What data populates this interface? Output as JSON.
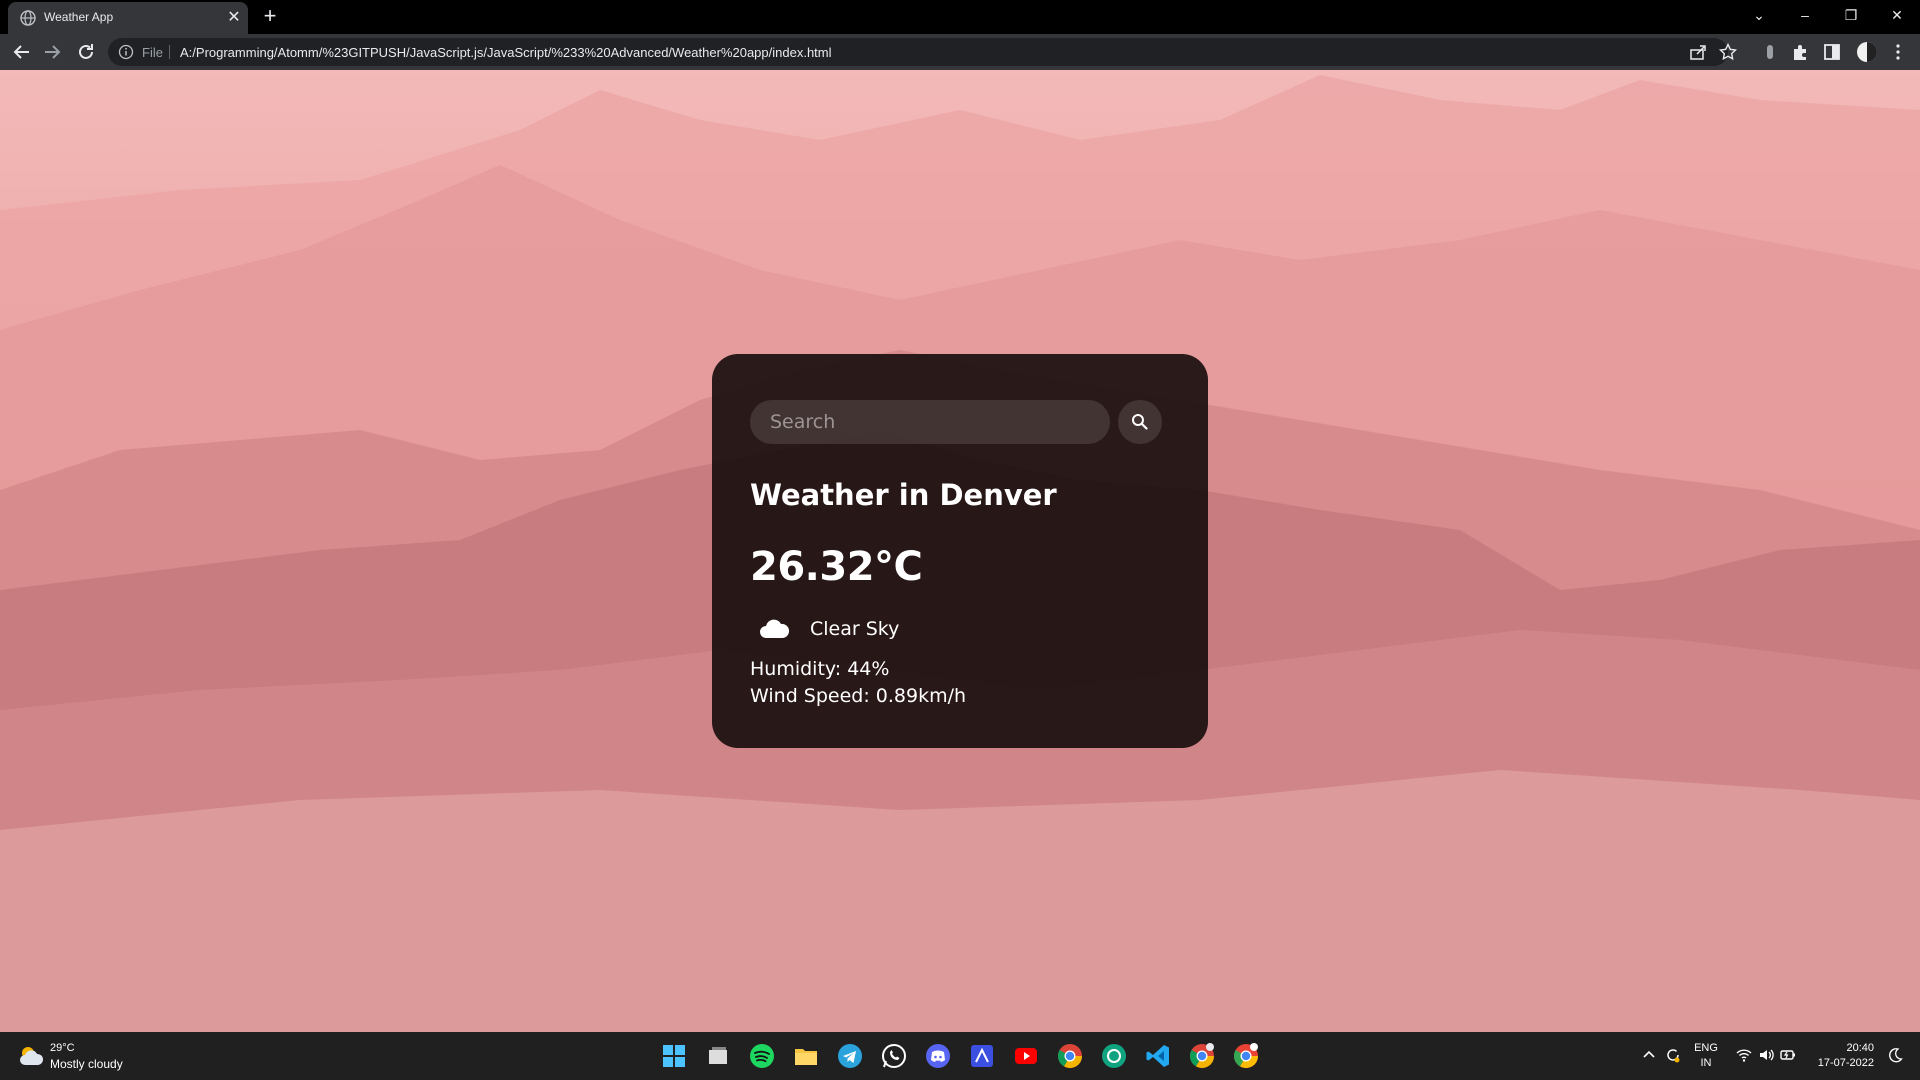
{
  "browser": {
    "tab_title": "Weather App",
    "url_scheme": "File",
    "url": "A:/Programming/Atomm/%23GITPUSH/JavaScript.js/JavaScript/%233%20Advanced/Weather%20app/index.html"
  },
  "search": {
    "placeholder": "Search",
    "value": ""
  },
  "weather": {
    "city_heading": "Weather in Denver",
    "temperature": "26.32°C",
    "condition": "Clear Sky",
    "condition_icon": "cloud-icon",
    "humidity": "Humidity: 44%",
    "wind_speed": "Wind Speed: 0.89km/h"
  },
  "taskbar": {
    "weather_temp": "29°C",
    "weather_condition": "Mostly cloudy",
    "apps": [
      "windows-start",
      "task-view",
      "spotify",
      "file-explorer",
      "telegram",
      "whatsapp",
      "discord",
      "adobe-app",
      "youtube",
      "chrome",
      "chatgpt",
      "vscode",
      "chrome-profile",
      "chrome-canary"
    ],
    "language": "ENG",
    "region": "IN",
    "time": "20:40",
    "date": "17-07-2022"
  },
  "colors": {
    "card_bg": "#160c0c",
    "page_pink": "#eea9a8",
    "chrome_dark": "#35363a"
  }
}
